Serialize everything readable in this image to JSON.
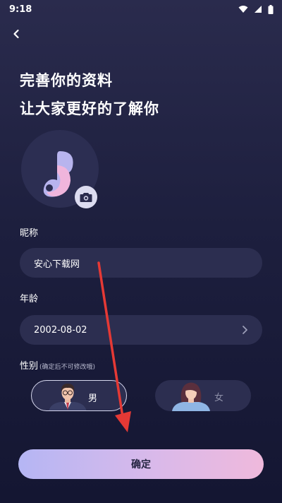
{
  "status_bar": {
    "time": "9:18"
  },
  "header": {
    "line1": "完善你的资料",
    "line2": "让大家更好的了解你"
  },
  "nickname": {
    "label": "昵称",
    "value": "安心下载网"
  },
  "age": {
    "label": "年龄",
    "value": "2002-08-02"
  },
  "gender": {
    "label": "性别",
    "hint": "(确定后不可修改哦)",
    "options": [
      {
        "label": "男",
        "selected": true
      },
      {
        "label": "女",
        "selected": false
      }
    ]
  },
  "confirm": {
    "label": "确定"
  },
  "colors": {
    "background_top": "#2a2b4d",
    "background_bottom": "#141632",
    "field_bg": "#2c2e50",
    "button_gradient_start": "#b5b6f4",
    "button_gradient_end": "#efb9dc",
    "annotation_arrow": "#e53935"
  },
  "icons": [
    "back-arrow-icon",
    "wifi-icon",
    "signal-icon",
    "battery-icon",
    "music-note-logo-icon",
    "camera-icon",
    "chevron-right-icon",
    "male-avatar-icon",
    "female-avatar-icon"
  ]
}
